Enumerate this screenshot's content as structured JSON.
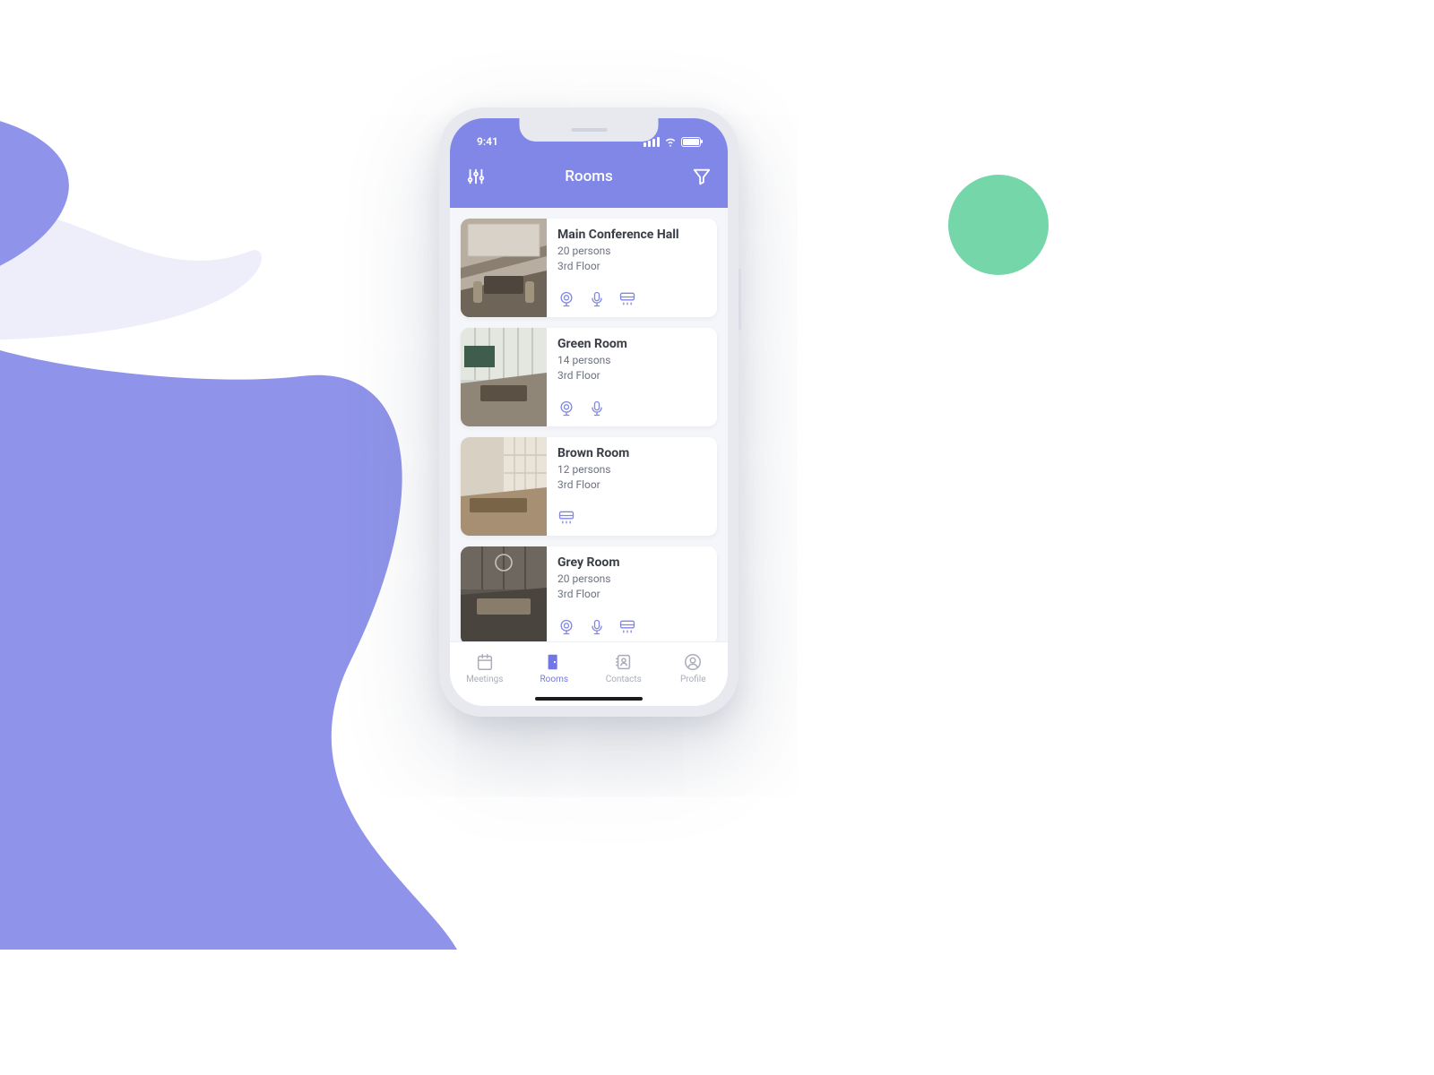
{
  "statusbar": {
    "time": "9:41"
  },
  "header": {
    "title": "Rooms"
  },
  "rooms": [
    {
      "name": "Main Conference Hall",
      "capacity": "20 persons",
      "floor": "3rd Floor",
      "webcam": true,
      "mic": true,
      "ac": true
    },
    {
      "name": "Green Room",
      "capacity": "14 persons",
      "floor": "3rd Floor",
      "webcam": true,
      "mic": true,
      "ac": false
    },
    {
      "name": "Brown Room",
      "capacity": "12 persons",
      "floor": "3rd Floor",
      "webcam": false,
      "mic": false,
      "ac": true
    },
    {
      "name": "Grey Room",
      "capacity": "20 persons",
      "floor": "3rd Floor",
      "webcam": true,
      "mic": true,
      "ac": true
    }
  ],
  "tabs": [
    {
      "label": "Meetings",
      "active": false
    },
    {
      "label": "Rooms",
      "active": true
    },
    {
      "label": "Contacts",
      "active": false
    },
    {
      "label": "Profile",
      "active": false
    }
  ]
}
